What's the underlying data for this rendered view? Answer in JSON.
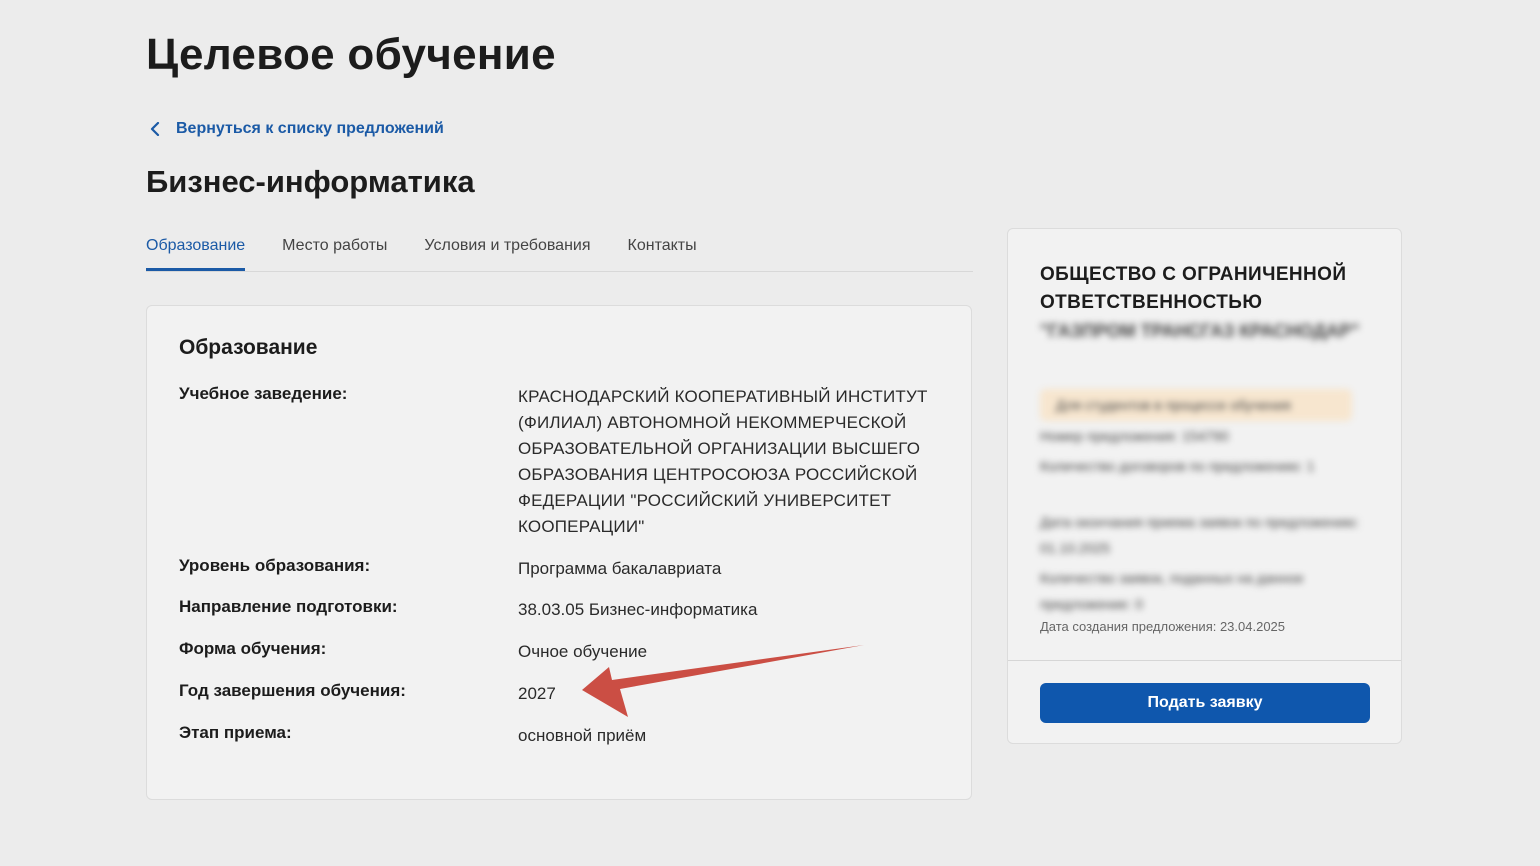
{
  "page_title": "Целевое обучение",
  "back_link": "Вернуться к списку предложений",
  "program_title": "Бизнес-информатика",
  "tabs": [
    "Образование",
    "Место работы",
    "Условия и требования",
    "Контакты"
  ],
  "section": {
    "title": "Образование",
    "rows": [
      {
        "label": "Учебное заведение:",
        "value": "КРАСНОДАРСКИЙ КООПЕРАТИВНЫЙ ИНСТИТУТ (ФИЛИАЛ) АВТОНОМНОЙ НЕКОММЕРЧЕСКОЙ ОБРАЗОВАТЕЛЬНОЙ ОРГАНИЗАЦИИ ВЫСШЕГО ОБРАЗОВАНИЯ ЦЕНТРОСОЮЗА РОССИЙСКОЙ ФЕДЕРАЦИИ \"РОССИЙСКИЙ УНИВЕРСИТЕТ КООПЕРАЦИИ\""
      },
      {
        "label": "Уровень образования:",
        "value": "Программа бакалавриата"
      },
      {
        "label": "Направление подготовки:",
        "value": "38.03.05 Бизнес-информатика"
      },
      {
        "label": "Форма обучения:",
        "value": "Очное обучение"
      },
      {
        "label": "Год завершения обучения:",
        "value": "2027"
      },
      {
        "label": "Этап приема:",
        "value": "основной приём"
      }
    ]
  },
  "sidebar": {
    "org_name": "ОБЩЕСТВО С ОГРАНИЧЕННОЙ ОТВЕТСТВЕННОСТЬЮ",
    "created": "Дата создания предложения: 23.04.2025",
    "apply_label": "Подать заявку"
  },
  "colors": {
    "accent": "#1b5aa6",
    "button": "#0f57ad",
    "arrow": "#c8443a",
    "badge": "#f7e6cf"
  }
}
